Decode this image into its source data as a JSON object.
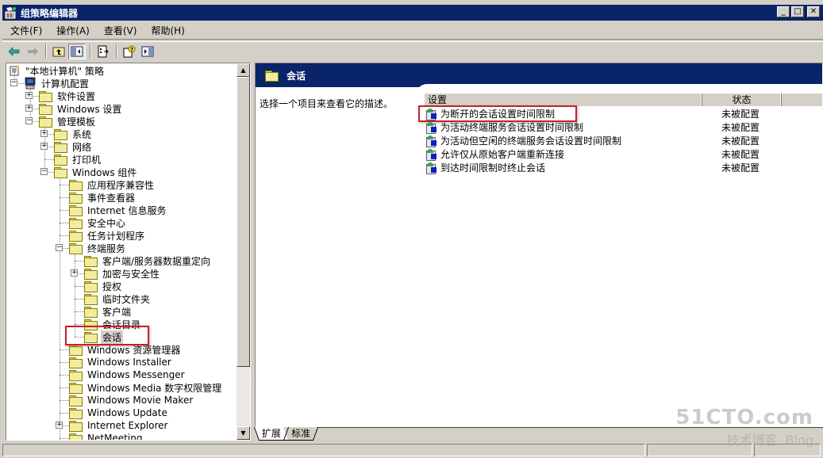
{
  "window": {
    "title": "组策略编辑器",
    "controls": {
      "minimize": "_",
      "maximize": "□",
      "close": "✕"
    }
  },
  "menubar": {
    "items": [
      {
        "label": "文件(F)"
      },
      {
        "label": "操作(A)"
      },
      {
        "label": "查看(V)"
      },
      {
        "label": "帮助(H)"
      }
    ]
  },
  "toolbar": {
    "buttons": [
      "back-icon",
      "forward-icon",
      "up-level-icon",
      "show-hide-tree-icon",
      "export-list-icon",
      "help-icon",
      "show-hide-action-pane-icon"
    ]
  },
  "tree": {
    "root": "\"本地计算机\" 策略",
    "nodes": [
      {
        "label": "计算机配置",
        "level": 1,
        "expander": "-"
      },
      {
        "label": "软件设置",
        "level": 2,
        "expander": "+"
      },
      {
        "label": "Windows 设置",
        "level": 2,
        "expander": "+"
      },
      {
        "label": "管理模板",
        "level": 2,
        "expander": "-"
      },
      {
        "label": "系统",
        "level": 3,
        "expander": "+"
      },
      {
        "label": "网络",
        "level": 3,
        "expander": "+"
      },
      {
        "label": "打印机",
        "level": 3,
        "expander": ""
      },
      {
        "label": "Windows 组件",
        "level": 3,
        "expander": "-"
      },
      {
        "label": "应用程序兼容性",
        "level": 4,
        "expander": ""
      },
      {
        "label": "事件查看器",
        "level": 4,
        "expander": ""
      },
      {
        "label": "Internet 信息服务",
        "level": 4,
        "expander": ""
      },
      {
        "label": "安全中心",
        "level": 4,
        "expander": ""
      },
      {
        "label": "任务计划程序",
        "level": 4,
        "expander": ""
      },
      {
        "label": "终端服务",
        "level": 4,
        "expander": "-"
      },
      {
        "label": "客户端/服务器数据重定向",
        "level": 5,
        "expander": ""
      },
      {
        "label": "加密与安全性",
        "level": 5,
        "expander": "+"
      },
      {
        "label": "授权",
        "level": 5,
        "expander": ""
      },
      {
        "label": "临时文件夹",
        "level": 5,
        "expander": ""
      },
      {
        "label": "客户端",
        "level": 5,
        "expander": ""
      },
      {
        "label": "会话目录",
        "level": 5,
        "expander": ""
      },
      {
        "label": "会话",
        "level": 5,
        "expander": "",
        "selected": true
      },
      {
        "label": "Windows 资源管理器",
        "level": 4,
        "expander": ""
      },
      {
        "label": "Windows Installer",
        "level": 4,
        "expander": ""
      },
      {
        "label": "Windows Messenger",
        "level": 4,
        "expander": ""
      },
      {
        "label": "Windows Media 数字权限管理",
        "level": 4,
        "expander": ""
      },
      {
        "label": "Windows Movie Maker",
        "level": 4,
        "expander": ""
      },
      {
        "label": "Windows Update",
        "level": 4,
        "expander": ""
      },
      {
        "label": "Internet Explorer",
        "level": 4,
        "expander": "+"
      },
      {
        "label": "NetMeeting",
        "level": 4,
        "expander": ""
      }
    ]
  },
  "details": {
    "header_title": "会话",
    "description": "选择一个项目来查看它的描述。",
    "columns": {
      "setting": "设置",
      "state": "状态"
    },
    "rows": [
      {
        "setting": "为断开的会话设置时间限制",
        "state": "未被配置",
        "highlighted": true
      },
      {
        "setting": "为活动终端服务会话设置时间限制",
        "state": "未被配置"
      },
      {
        "setting": "为活动但空闲的终端服务会话设置时间限制",
        "state": "未被配置"
      },
      {
        "setting": "允许仅从原始客户端重新连接",
        "state": "未被配置"
      },
      {
        "setting": "到达时间限制时终止会话",
        "state": "未被配置"
      }
    ]
  },
  "tabs": [
    {
      "label": "扩展",
      "active": true
    },
    {
      "label": "标准",
      "active": false
    }
  ],
  "watermark": {
    "line1": "51CTO.com",
    "line2": "技术博客",
    "line3": "Blog"
  },
  "colors": {
    "titlebar": "#0a246a",
    "highlight_box": "#c8202a",
    "chrome": "#d4d0c8"
  }
}
